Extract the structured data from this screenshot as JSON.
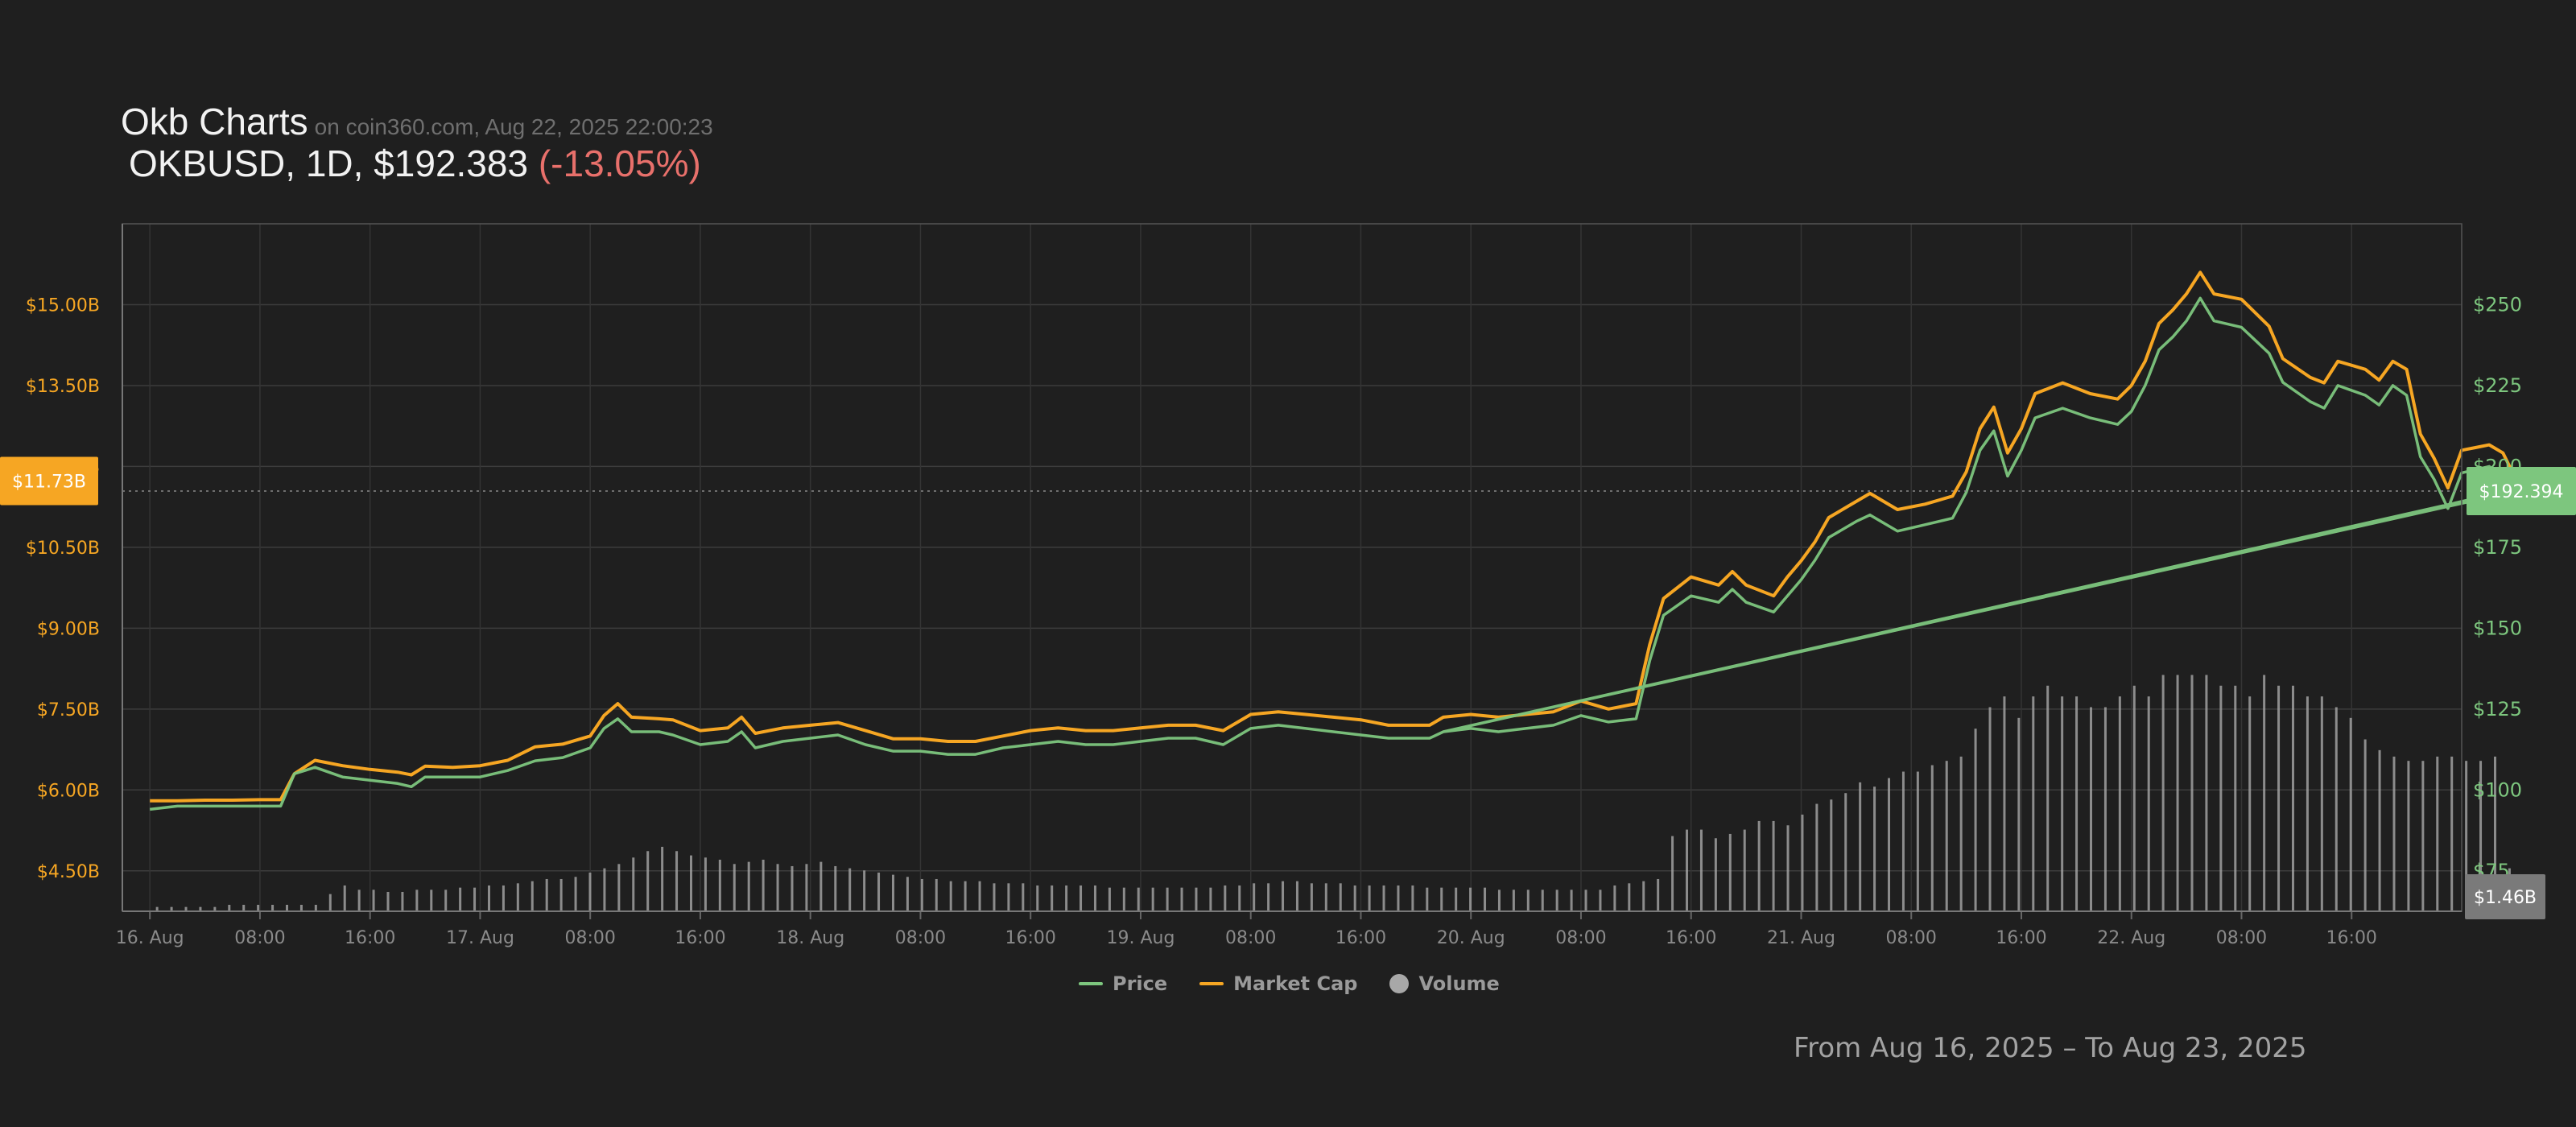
{
  "header": {
    "title": "Okb Charts",
    "subtitle": "on coin360.com, Aug 22, 2025 22:00:23",
    "pair_prefix": "OKBUSD, 1D, $192.383",
    "change": "(-13.05%)"
  },
  "legend": {
    "price": "Price",
    "market_cap": "Market Cap",
    "volume": "Volume"
  },
  "footer": {
    "range": "From Aug 16, 2025 – To Aug 23, 2025"
  },
  "colors": {
    "background": "#1f1f1f",
    "price": "#7dc67e",
    "market_cap": "#f6a623",
    "volume": "#a8a8a8",
    "negative": "#e8706b"
  },
  "chart_data": {
    "type": "line",
    "x_tick_labels": [
      "16. Aug",
      "08:00",
      "16:00",
      "17. Aug",
      "08:00",
      "16:00",
      "18. Aug",
      "08:00",
      "16:00",
      "19. Aug",
      "08:00",
      "16:00",
      "20. Aug",
      "08:00",
      "16:00",
      "21. Aug",
      "08:00",
      "16:00",
      "22. Aug",
      "08:00",
      "16:00"
    ],
    "x_range_hours": [
      -2,
      168
    ],
    "y_right": {
      "label": "Price",
      "ticks": [
        75,
        100,
        125,
        150,
        175,
        200,
        225,
        250
      ],
      "tick_labels": [
        "$75",
        "$100",
        "$125",
        "$150",
        "$175",
        "$200",
        "$225",
        "$250"
      ],
      "range": [
        62.5,
        275
      ]
    },
    "y_left": {
      "label": "Market Cap",
      "ticks": [
        4.5,
        6.0,
        7.5,
        9.0,
        10.5,
        12.0,
        13.5,
        15.0
      ],
      "tick_labels": [
        "$4.50B",
        "$6.00B",
        "$7.50B",
        "$9.00B",
        "$10.50B",
        "$12.00B",
        "$13.50B",
        "$15.00B"
      ],
      "range": [
        3.75,
        16.5
      ]
    },
    "current_marketcap_label": "$11.73B",
    "current_price_label": "$192.394",
    "current_volume_label": "$1.46B",
    "current_price": 192.394,
    "current_marketcap": 11.73,
    "price_series": {
      "name": "Price",
      "points": [
        [
          0,
          94
        ],
        [
          2,
          95
        ],
        [
          4,
          95
        ],
        [
          6,
          95
        ],
        [
          8,
          95
        ],
        [
          9.5,
          95
        ],
        [
          10.5,
          105
        ],
        [
          12,
          107
        ],
        [
          14,
          104
        ],
        [
          16,
          103
        ],
        [
          18,
          102
        ],
        [
          19,
          101
        ],
        [
          20,
          104
        ],
        [
          22,
          104
        ],
        [
          24,
          104
        ],
        [
          26,
          106
        ],
        [
          28,
          109
        ],
        [
          30,
          110
        ],
        [
          32,
          113
        ],
        [
          33,
          119
        ],
        [
          34,
          122
        ],
        [
          35,
          118
        ],
        [
          37,
          118
        ],
        [
          38,
          117
        ],
        [
          40,
          114
        ],
        [
          42,
          115
        ],
        [
          43,
          118
        ],
        [
          44,
          113
        ],
        [
          46,
          115
        ],
        [
          48,
          116
        ],
        [
          50,
          117
        ],
        [
          52,
          114
        ],
        [
          54,
          112
        ],
        [
          56,
          112
        ],
        [
          58,
          111
        ],
        [
          60,
          111
        ],
        [
          62,
          113
        ],
        [
          64,
          114
        ],
        [
          66,
          115
        ],
        [
          68,
          114
        ],
        [
          70,
          114
        ],
        [
          72,
          115
        ],
        [
          74,
          116
        ],
        [
          76,
          116
        ],
        [
          78,
          114
        ],
        [
          80,
          119
        ],
        [
          82,
          120
        ],
        [
          84,
          119
        ],
        [
          86,
          118
        ],
        [
          88,
          117
        ],
        [
          90,
          116
        ],
        [
          92,
          116
        ],
        [
          93,
          116
        ],
        [
          94,
          118
        ],
        [
          96,
          119
        ],
        [
          98,
          118
        ],
        [
          100,
          119
        ],
        [
          102,
          120
        ],
        [
          104,
          123
        ],
        [
          106,
          121
        ],
        [
          108,
          122
        ],
        [
          109,
          140
        ],
        [
          110,
          154
        ],
        [
          112,
          160
        ],
        [
          114,
          158
        ],
        [
          115,
          162
        ],
        [
          116,
          158
        ],
        [
          118,
          155
        ],
        [
          119,
          160
        ],
        [
          120,
          165
        ],
        [
          121,
          171
        ],
        [
          122,
          178
        ],
        [
          124,
          183
        ],
        [
          125,
          185
        ],
        [
          127,
          180
        ],
        [
          129,
          182
        ],
        [
          131,
          184
        ],
        [
          132,
          192
        ],
        [
          133,
          205
        ],
        [
          134,
          211
        ],
        [
          135,
          197
        ],
        [
          136,
          205
        ],
        [
          137,
          215
        ],
        [
          139,
          218
        ],
        [
          141,
          215
        ],
        [
          143,
          213
        ],
        [
          144,
          217
        ],
        [
          145,
          225
        ],
        [
          146,
          236
        ],
        [
          147,
          240
        ],
        [
          148,
          245
        ],
        [
          149,
          252
        ],
        [
          150,
          245
        ],
        [
          152,
          243
        ],
        [
          154,
          235
        ],
        [
          155,
          226
        ],
        [
          157,
          220
        ],
        [
          158,
          218
        ],
        [
          159,
          225
        ],
        [
          161,
          222
        ],
        [
          162,
          219
        ],
        [
          163,
          225
        ],
        [
          164,
          222
        ],
        [
          165,
          203
        ],
        [
          166,
          196
        ],
        [
          167,
          187
        ],
        [
          168,
          198
        ],
        [
          169,
          199
        ],
        [
          170,
          200
        ],
        [
          171,
          197
        ],
        [
          172,
          193
        ],
        [
          94,
          118
        ],
        [
          172,
          192.4
        ]
      ]
    },
    "marketcap_series": {
      "name": "Market Cap",
      "points": [
        [
          0,
          5.8
        ],
        [
          2,
          5.8
        ],
        [
          4,
          5.81
        ],
        [
          6,
          5.81
        ],
        [
          8,
          5.82
        ],
        [
          9.5,
          5.82
        ],
        [
          10.5,
          6.3
        ],
        [
          12,
          6.55
        ],
        [
          14,
          6.45
        ],
        [
          16,
          6.38
        ],
        [
          18,
          6.33
        ],
        [
          19,
          6.28
        ],
        [
          20,
          6.44
        ],
        [
          22,
          6.42
        ],
        [
          24,
          6.45
        ],
        [
          26,
          6.55
        ],
        [
          28,
          6.8
        ],
        [
          30,
          6.85
        ],
        [
          32,
          7.0
        ],
        [
          33,
          7.38
        ],
        [
          34,
          7.6
        ],
        [
          35,
          7.35
        ],
        [
          37,
          7.32
        ],
        [
          38,
          7.3
        ],
        [
          40,
          7.1
        ],
        [
          42,
          7.15
        ],
        [
          43,
          7.35
        ],
        [
          44,
          7.05
        ],
        [
          46,
          7.15
        ],
        [
          48,
          7.2
        ],
        [
          50,
          7.25
        ],
        [
          52,
          7.1
        ],
        [
          54,
          6.95
        ],
        [
          56,
          6.95
        ],
        [
          58,
          6.9
        ],
        [
          60,
          6.9
        ],
        [
          62,
          7.0
        ],
        [
          64,
          7.1
        ],
        [
          66,
          7.15
        ],
        [
          68,
          7.1
        ],
        [
          70,
          7.1
        ],
        [
          72,
          7.15
        ],
        [
          74,
          7.2
        ],
        [
          76,
          7.2
        ],
        [
          78,
          7.1
        ],
        [
          80,
          7.4
        ],
        [
          82,
          7.45
        ],
        [
          84,
          7.4
        ],
        [
          86,
          7.35
        ],
        [
          88,
          7.3
        ],
        [
          90,
          7.2
        ],
        [
          92,
          7.2
        ],
        [
          93,
          7.2
        ],
        [
          94,
          7.35
        ],
        [
          96,
          7.4
        ],
        [
          98,
          7.35
        ],
        [
          100,
          7.4
        ],
        [
          102,
          7.45
        ],
        [
          104,
          7.65
        ],
        [
          106,
          7.5
        ],
        [
          108,
          7.6
        ],
        [
          109,
          8.7
        ],
        [
          110,
          9.55
        ],
        [
          112,
          9.95
        ],
        [
          114,
          9.8
        ],
        [
          115,
          10.05
        ],
        [
          116,
          9.8
        ],
        [
          118,
          9.6
        ],
        [
          119,
          9.95
        ],
        [
          120,
          10.25
        ],
        [
          121,
          10.6
        ],
        [
          122,
          11.05
        ],
        [
          124,
          11.35
        ],
        [
          125,
          11.5
        ],
        [
          127,
          11.2
        ],
        [
          129,
          11.3
        ],
        [
          131,
          11.45
        ],
        [
          132,
          11.9
        ],
        [
          133,
          12.7
        ],
        [
          134,
          13.1
        ],
        [
          135,
          12.25
        ],
        [
          136,
          12.7
        ],
        [
          137,
          13.35
        ],
        [
          139,
          13.55
        ],
        [
          141,
          13.35
        ],
        [
          143,
          13.25
        ],
        [
          144,
          13.5
        ],
        [
          145,
          13.95
        ],
        [
          146,
          14.65
        ],
        [
          147,
          14.9
        ],
        [
          148,
          15.2
        ],
        [
          149,
          15.6
        ],
        [
          150,
          15.2
        ],
        [
          152,
          15.1
        ],
        [
          154,
          14.6
        ],
        [
          155,
          14.0
        ],
        [
          157,
          13.65
        ],
        [
          158,
          13.55
        ],
        [
          159,
          13.95
        ],
        [
          161,
          13.8
        ],
        [
          162,
          13.6
        ],
        [
          163,
          13.95
        ],
        [
          164,
          13.8
        ],
        [
          165,
          12.6
        ],
        [
          166,
          12.15
        ],
        [
          167,
          11.6
        ],
        [
          168,
          12.3
        ],
        [
          169,
          12.35
        ],
        [
          170,
          12.4
        ],
        [
          171,
          12.25
        ],
        [
          172,
          11.73
        ]
      ]
    },
    "volume_series": {
      "name": "Volume",
      "values": [
        0.02,
        0.02,
        0.02,
        0.02,
        0.02,
        0.03,
        0.03,
        0.03,
        0.03,
        0.03,
        0.03,
        0.03,
        0.08,
        0.12,
        0.1,
        0.1,
        0.09,
        0.09,
        0.1,
        0.1,
        0.1,
        0.11,
        0.11,
        0.12,
        0.12,
        0.13,
        0.14,
        0.15,
        0.15,
        0.16,
        0.18,
        0.2,
        0.22,
        0.25,
        0.28,
        0.3,
        0.28,
        0.26,
        0.25,
        0.24,
        0.22,
        0.23,
        0.24,
        0.22,
        0.21,
        0.22,
        0.23,
        0.21,
        0.2,
        0.19,
        0.18,
        0.17,
        0.16,
        0.15,
        0.15,
        0.14,
        0.14,
        0.14,
        0.13,
        0.13,
        0.13,
        0.12,
        0.12,
        0.12,
        0.12,
        0.12,
        0.11,
        0.11,
        0.11,
        0.11,
        0.11,
        0.11,
        0.11,
        0.11,
        0.12,
        0.12,
        0.13,
        0.13,
        0.14,
        0.14,
        0.13,
        0.13,
        0.13,
        0.12,
        0.12,
        0.12,
        0.12,
        0.12,
        0.11,
        0.11,
        0.11,
        0.11,
        0.11,
        0.1,
        0.1,
        0.1,
        0.1,
        0.1,
        0.1,
        0.1,
        0.1,
        0.12,
        0.13,
        0.14,
        0.15,
        0.35,
        0.38,
        0.38,
        0.34,
        0.36,
        0.38,
        0.42,
        0.42,
        0.4,
        0.45,
        0.5,
        0.52,
        0.55,
        0.6,
        0.58,
        0.62,
        0.65,
        0.65,
        0.68,
        0.7,
        0.72,
        0.85,
        0.95,
        1.0,
        0.9,
        1.0,
        1.05,
        1.0,
        1.0,
        0.95,
        0.95,
        1.0,
        1.05,
        1.0,
        1.1,
        1.1,
        1.1,
        1.1,
        1.05,
        1.05,
        1.0,
        1.1,
        1.05,
        1.05,
        1.0,
        1.0,
        0.95,
        0.9,
        0.8,
        0.75,
        0.72,
        0.7,
        0.7,
        0.72,
        0.72,
        0.7,
        0.7,
        0.72,
        0.2
      ],
      "range": [
        0,
        3.2
      ]
    }
  }
}
